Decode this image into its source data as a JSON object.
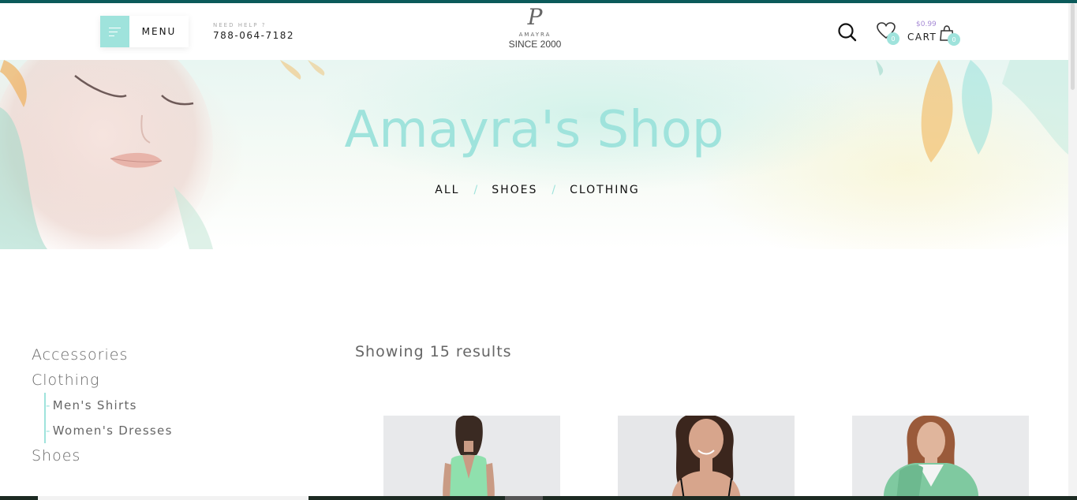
{
  "header": {
    "menu_label": "MENU",
    "help_label": "NEED HELP ?",
    "help_phone": "788-064-7182",
    "logo_mark": "P",
    "logo_name": "AMAYRA",
    "logo_since": "SINCE 2000",
    "wishlist_count": "0",
    "cart_price": "$0.99",
    "cart_label": "CART",
    "cart_count": "0"
  },
  "hero": {
    "title": "Amayra's Shop",
    "filters": [
      "ALL",
      "SHOES",
      "CLOTHING"
    ],
    "separator": "/"
  },
  "sidebar": {
    "categories": [
      {
        "label": "Accessories"
      },
      {
        "label": "Clothing",
        "children": [
          "Men's Shirts",
          "Women's Dresses"
        ]
      },
      {
        "label": "Shoes"
      }
    ]
  },
  "main": {
    "results_text": "Showing 15 results"
  },
  "products": [
    {
      "image": "woman-in-green-dress"
    },
    {
      "image": "woman-in-slip-dress"
    },
    {
      "image": "woman-in-green-coat"
    }
  ],
  "colors": {
    "accent": "#9fe3dc",
    "top_strip": "#0b5a5a",
    "price": "#a78bd6"
  },
  "icons": [
    "menu-icon",
    "search-icon",
    "heart-icon",
    "shopping-bag-icon"
  ]
}
